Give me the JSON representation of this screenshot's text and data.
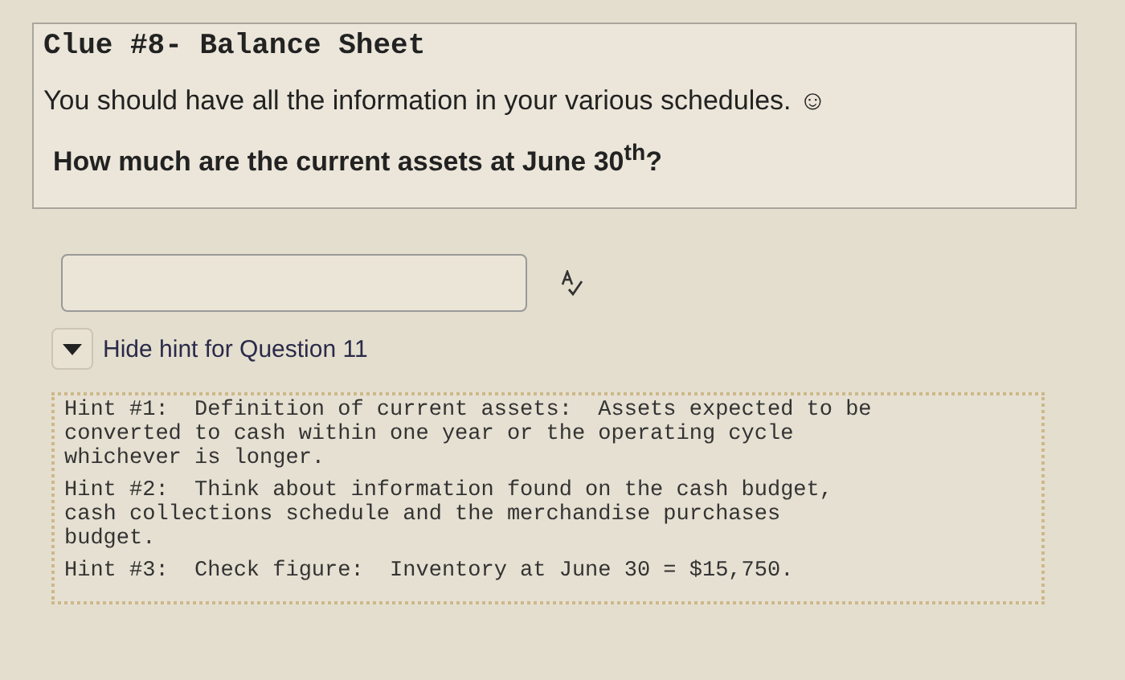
{
  "clue": {
    "title": "Clue #8- Balance Sheet",
    "intro": "You should have all the information in your various schedules.  ☺",
    "question": "How much are the current assets at June 30$^{th}$?"
  },
  "hint_toggle": {
    "label": "Hide hint for Question 11",
    "expanded": true
  },
  "hints": [
    {
      "text": "Hint #1:  Definition of current assets:  Assets expected to be\nconverted to cash within one year or the operating cycle\nwhichever is longer."
    },
    {
      "text": "Hint #2:  Think about information found on the cash budget,\ncash collections schedule and the merchandise purchases\nbudget."
    },
    {
      "text": "Hint #3:  Check figure:  Inventory at June 30 = $15,750."
    }
  ]
}
